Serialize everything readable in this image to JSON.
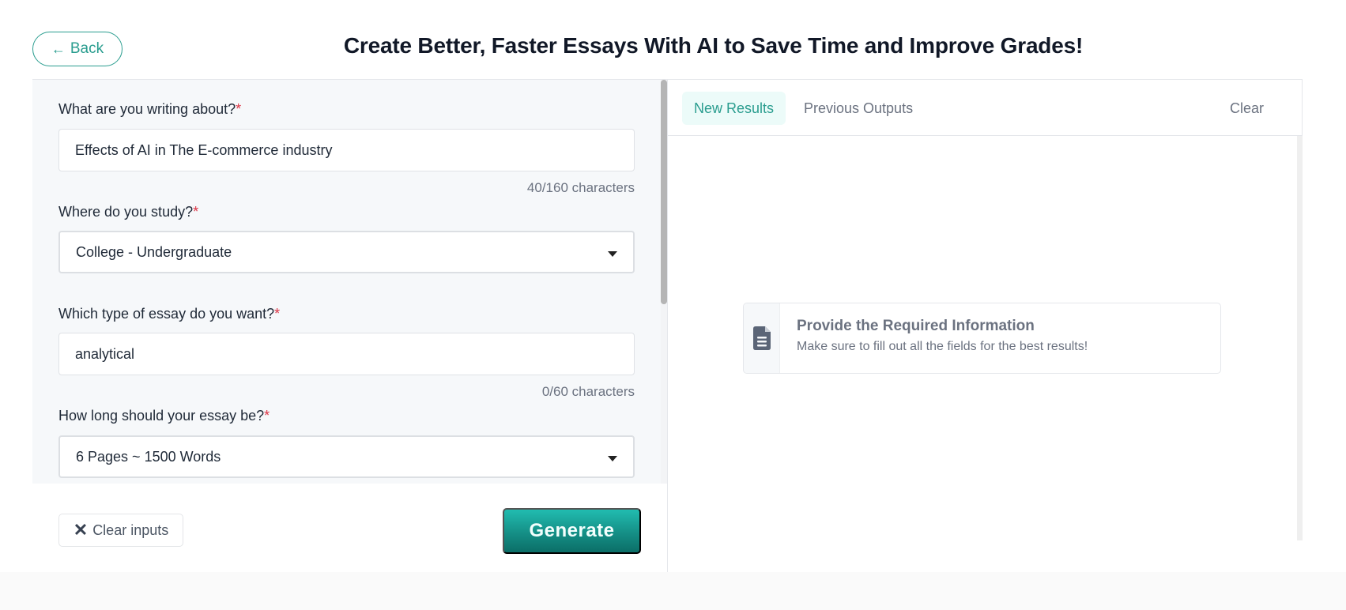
{
  "header": {
    "back_label": "Back",
    "back_icon": "arrow-left-icon",
    "title": "Create Better, Faster Essays With AI to Save Time and Improve Grades!"
  },
  "form": {
    "fields": [
      {
        "label": "What are you writing about?",
        "required_mark": "*",
        "type": "text",
        "value": "Effects of AI in The E-commerce industry",
        "counter": "40/160 characters"
      },
      {
        "label": "Where do you study?",
        "required_mark": "*",
        "type": "select",
        "value": "College - Undergraduate"
      },
      {
        "label": "Which type of essay do you want?",
        "required_mark": "*",
        "type": "text",
        "value": "analytical",
        "counter": "0/60 characters"
      },
      {
        "label": "How long should your essay be?",
        "required_mark": "*",
        "type": "select",
        "value": "6 Pages ~ 1500 Words"
      }
    ],
    "clear_inputs_icon": "x",
    "clear_inputs_label": "Clear inputs",
    "generate_label": "Generate"
  },
  "results": {
    "tabs": [
      {
        "label": "New Results",
        "active": true
      },
      {
        "label": "Previous Outputs",
        "active": false
      }
    ],
    "clear_label": "Clear",
    "empty_state": {
      "icon": "file-text-icon",
      "title": "Provide the Required Information",
      "subtitle": "Make sure to fill out all the fields for the best results!"
    }
  },
  "colors": {
    "accent": "#2a9d8f",
    "required": "#dc3545",
    "generate_top": "#21bcb0",
    "generate_bottom": "#0b6e67"
  }
}
